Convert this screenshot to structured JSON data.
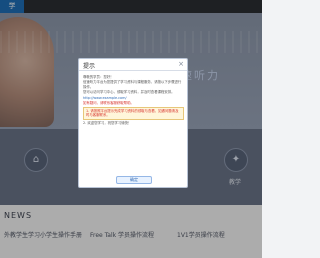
{
  "logo": "学",
  "hero": {
    "slogan": "信速听力"
  },
  "features": [
    {
      "icon": "home-icon",
      "glyph": "⌂",
      "label": ""
    },
    {
      "icon": "video-icon",
      "glyph": "▣",
      "label": ""
    },
    {
      "icon": "book-icon",
      "glyph": "▥",
      "label": ""
    },
    {
      "icon": "bulb-icon",
      "glyph": "✦",
      "label": "教学"
    }
  ],
  "news": {
    "title": "NEWS",
    "items": [
      {
        "title": "外教学生学习小学生操作手册",
        "sub": ""
      },
      {
        "title": "Free Talk 学员操作流程",
        "sub": ""
      },
      {
        "title": "1V1学员操作流程",
        "sub": ""
      }
    ]
  },
  "modal": {
    "title": "提示",
    "close": "×",
    "paragraphs": [
      {
        "text": "尊敬的学员：您好！",
        "style": ""
      },
      {
        "text": "信速听力平台为您提供了学习资料与课程服务，请按以下步骤进行操作。",
        "style": ""
      },
      {
        "text": "您可以访问学习中心，领取学习资料，并及时查看课程安排。",
        "style": ""
      },
      {
        "text": "http://www.example.com/",
        "style": "link"
      },
      {
        "text": "如有疑问，请联系客服获取帮助。",
        "style": "red"
      },
      {
        "text": "1. 请按照平台提示完成学习资料的领取与查看，如遇问题请及时与客服联系。",
        "style": "alert"
      },
      {
        "text": "2. 欢迎您学习，祝您学习愉快！",
        "style": ""
      }
    ],
    "ok_label": "确定"
  }
}
